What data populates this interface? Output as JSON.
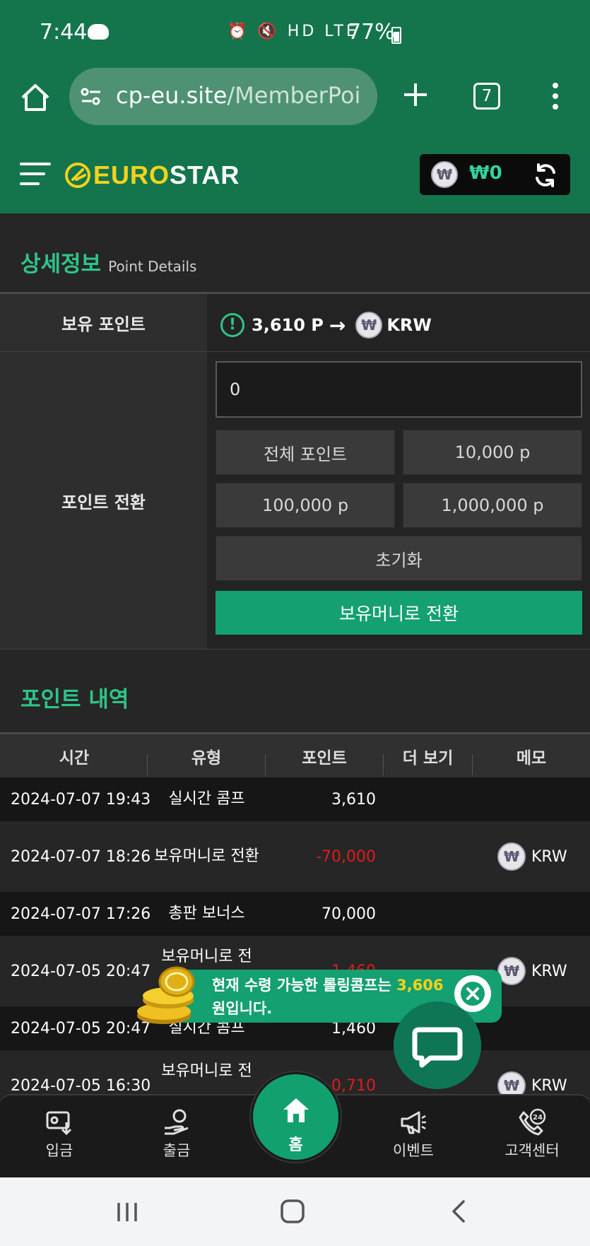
{
  "status_bar": {
    "time": "7:44",
    "icons": "⏰ 🔇 HD LTE",
    "battery": "77%"
  },
  "browser": {
    "url_host": "cp-eu.site",
    "url_path": "/MemberPoi",
    "tab_count": "7"
  },
  "header": {
    "logo_euro": "EURO",
    "logo_star": "STAR",
    "currency_symbol": "₩",
    "balance": "₩0"
  },
  "detail": {
    "title": "상세정보",
    "subtitle": "Point Details",
    "held_points_label": "보유 포인트",
    "held_points_value": "3,610 P",
    "arrow": "→",
    "target_currency": "KRW",
    "conversion_label": "포인트 전환",
    "input_value": "0",
    "buttons": [
      "전체 포인트",
      "10,000 p",
      "100,000 p",
      "1,000,000 p"
    ],
    "reset_label": "초기화",
    "convert_label": "보유머니로 전환"
  },
  "history": {
    "title": "포인트 내역",
    "columns": [
      "시간",
      "유형",
      "포인트",
      "더 보기",
      "메모"
    ],
    "rows": [
      {
        "time": "2024-07-07 19:43",
        "type": "실시간 콤프",
        "points": "3,610",
        "negative": false,
        "memo": ""
      },
      {
        "time": "2024-07-07 18:26",
        "type": "보유머니로 전환",
        "points": "-70,000",
        "negative": true,
        "memo": "KRW"
      },
      {
        "time": "2024-07-07 17:26",
        "type": "총판 보너스",
        "points": "70,000",
        "negative": false,
        "memo": ""
      },
      {
        "time": "2024-07-05 20:47",
        "type": "보유머니로 전",
        "points": "-1,460",
        "negative": true,
        "memo": "KRW"
      },
      {
        "time": "2024-07-05 20:47",
        "type": "실시간 콤프",
        "points": "1,460",
        "negative": false,
        "memo": ""
      },
      {
        "time": "2024-07-05 16:30",
        "type": "보유머니로 전",
        "points": "-0,710",
        "negative": true,
        "memo": "KRW"
      }
    ]
  },
  "toast": {
    "text_before": "현재 수령 가능한 롤링콤프는 ",
    "amount": "3,606",
    "text_after": " 원입니다."
  },
  "bottom_nav": {
    "deposit": "입금",
    "withdraw": "출금",
    "home": "홈",
    "event": "이벤트",
    "support": "고객센터"
  },
  "colors": {
    "brand_green": "#14754d",
    "accent_green": "#2ec488",
    "button_green": "#14a070",
    "negative_red": "#e01b1b",
    "logo_yellow": "#f2d31b"
  }
}
